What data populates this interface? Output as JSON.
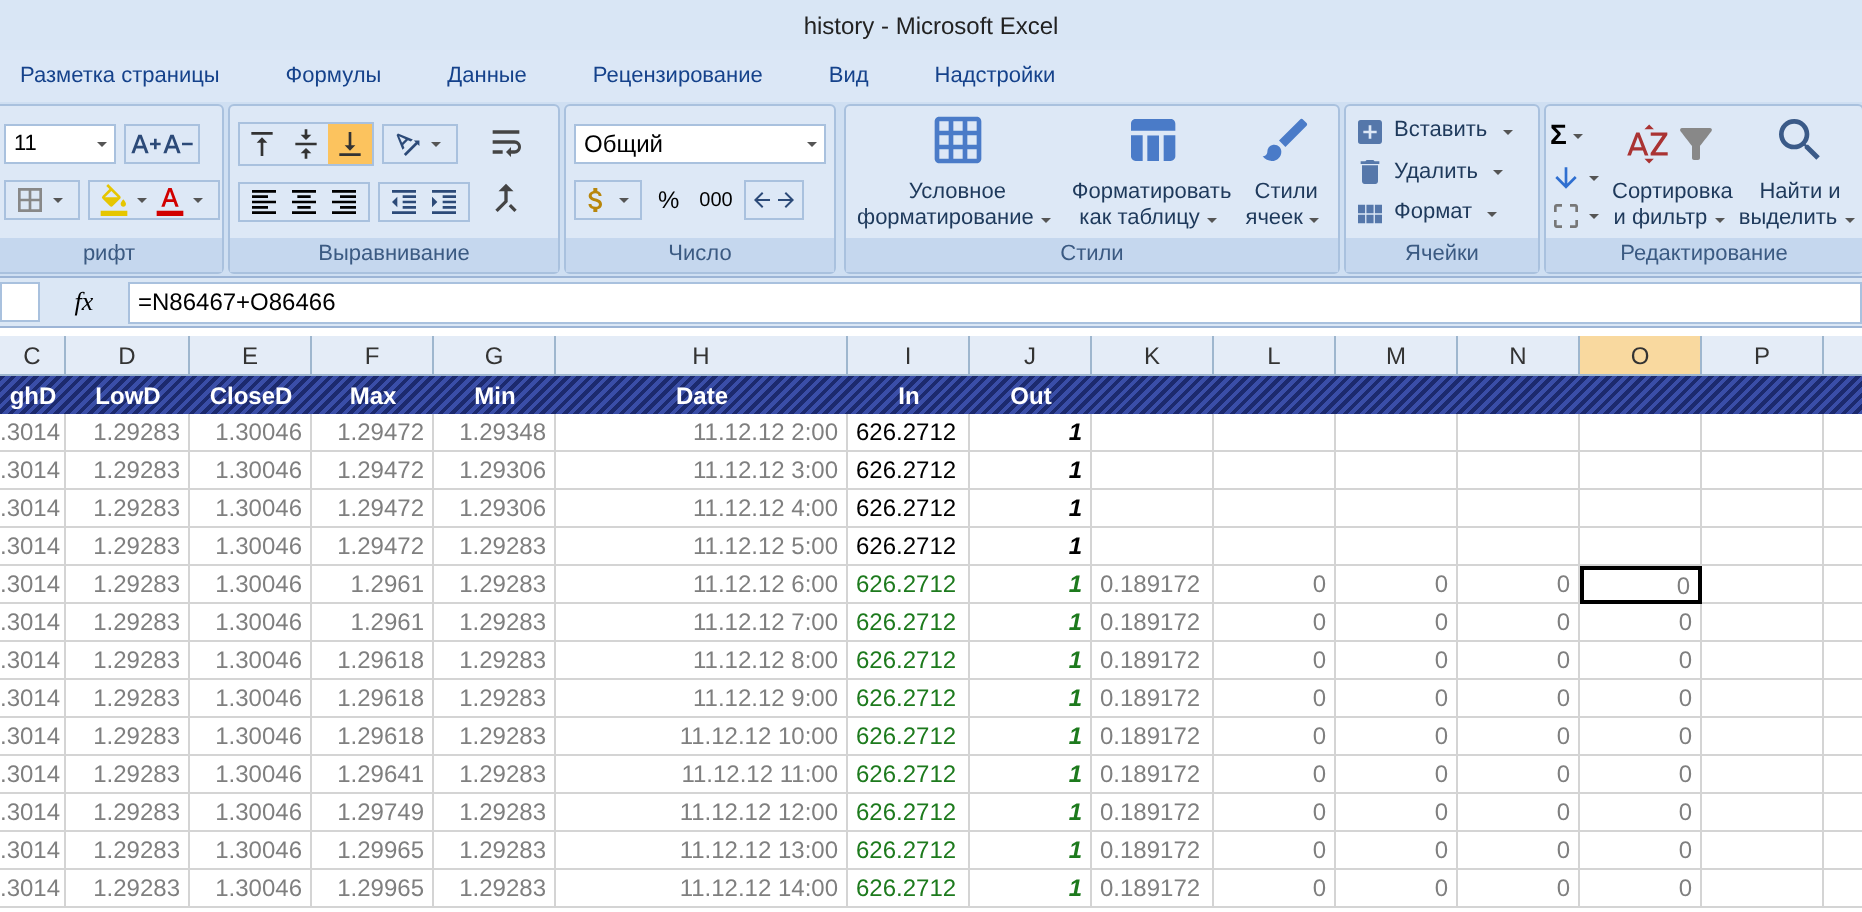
{
  "window": {
    "title": "history - Microsoft Excel"
  },
  "tabs": [
    {
      "label": "Разметка страницы",
      "selected": false
    },
    {
      "label": "Формулы",
      "selected": false
    },
    {
      "label": "Данные",
      "selected": false
    },
    {
      "label": "Рецензирование",
      "selected": false
    },
    {
      "label": "Вид",
      "selected": false
    },
    {
      "label": "Надстройки",
      "selected": false
    }
  ],
  "ribbon": {
    "font": {
      "label": "рифт",
      "size": "11"
    },
    "alignment": {
      "label": "Выравнивание",
      "vertical": [
        {
          "selected": false
        },
        {
          "selected": false
        },
        {
          "selected": true
        }
      ]
    },
    "number": {
      "label": "Число",
      "format": "Общий",
      "percent": "%",
      "thousands": "000"
    },
    "styles": {
      "label": "Стили",
      "buttons": [
        {
          "lines": [
            "Условное",
            "форматирование"
          ]
        },
        {
          "lines": [
            "Форматировать",
            "как таблицу"
          ]
        },
        {
          "lines": [
            "Стили",
            "ячеек"
          ]
        }
      ]
    },
    "cells": {
      "label": "Ячейки",
      "buttons": [
        "Вставить",
        "Удалить",
        "Формат"
      ]
    },
    "editing": {
      "label": "Редактирование",
      "sum": "Σ",
      "buttons": [
        {
          "lines": [
            "Сортировка",
            "и фильтр"
          ]
        },
        {
          "lines": [
            "Найти и",
            "выделить"
          ]
        }
      ]
    }
  },
  "formula_bar": {
    "fx": "fx",
    "formula": "=N86467+O86466"
  },
  "columns": [
    {
      "label": "C",
      "selected": false
    },
    {
      "label": "D",
      "selected": false
    },
    {
      "label": "E",
      "selected": false
    },
    {
      "label": "F",
      "selected": false
    },
    {
      "label": "G",
      "selected": false
    },
    {
      "label": "H",
      "selected": false
    },
    {
      "label": "I",
      "selected": false
    },
    {
      "label": "J",
      "selected": false
    },
    {
      "label": "K",
      "selected": false
    },
    {
      "label": "L",
      "selected": false
    },
    {
      "label": "M",
      "selected": false
    },
    {
      "label": "N",
      "selected": false
    },
    {
      "label": "O",
      "selected": true
    },
    {
      "label": "P",
      "selected": false
    }
  ],
  "header_row": [
    "ghD",
    "LowD",
    "CloseD",
    "Max",
    "Min",
    "Date",
    "In",
    "Out"
  ],
  "rows": [
    {
      "flagged": false,
      "selected": false,
      "cells": [
        ".3014",
        "1.29283",
        "1.30046",
        "1.29472",
        "1.29348",
        "11.12.12 2:00",
        "626.2712",
        "1"
      ]
    },
    {
      "flagged": false,
      "selected": false,
      "cells": [
        ".3014",
        "1.29283",
        "1.30046",
        "1.29472",
        "1.29306",
        "11.12.12 3:00",
        "626.2712",
        "1"
      ]
    },
    {
      "flagged": false,
      "selected": false,
      "cells": [
        ".3014",
        "1.29283",
        "1.30046",
        "1.29472",
        "1.29306",
        "11.12.12 4:00",
        "626.2712",
        "1"
      ]
    },
    {
      "flagged": false,
      "selected": false,
      "cells": [
        ".3014",
        "1.29283",
        "1.30046",
        "1.29472",
        "1.29283",
        "11.12.12 5:00",
        "626.2712",
        "1"
      ]
    },
    {
      "flagged": true,
      "selected": true,
      "cells": [
        ".3014",
        "1.29283",
        "1.30046",
        "1.2961",
        "1.29283",
        "11.12.12 6:00",
        "626.2712",
        "1",
        "0.189172",
        "0",
        "0",
        "0",
        "0"
      ]
    },
    {
      "flagged": true,
      "selected": false,
      "cells": [
        ".3014",
        "1.29283",
        "1.30046",
        "1.2961",
        "1.29283",
        "11.12.12 7:00",
        "626.2712",
        "1",
        "0.189172",
        "0",
        "0",
        "0",
        "0"
      ]
    },
    {
      "flagged": true,
      "selected": false,
      "cells": [
        ".3014",
        "1.29283",
        "1.30046",
        "1.29618",
        "1.29283",
        "11.12.12 8:00",
        "626.2712",
        "1",
        "0.189172",
        "0",
        "0",
        "0",
        "0"
      ]
    },
    {
      "flagged": true,
      "selected": false,
      "cells": [
        ".3014",
        "1.29283",
        "1.30046",
        "1.29618",
        "1.29283",
        "11.12.12 9:00",
        "626.2712",
        "1",
        "0.189172",
        "0",
        "0",
        "0",
        "0"
      ]
    },
    {
      "flagged": true,
      "selected": false,
      "cells": [
        ".3014",
        "1.29283",
        "1.30046",
        "1.29618",
        "1.29283",
        "11.12.12 10:00",
        "626.2712",
        "1",
        "0.189172",
        "0",
        "0",
        "0",
        "0"
      ]
    },
    {
      "flagged": true,
      "selected": false,
      "cells": [
        ".3014",
        "1.29283",
        "1.30046",
        "1.29641",
        "1.29283",
        "11.12.12 11:00",
        "626.2712",
        "1",
        "0.189172",
        "0",
        "0",
        "0",
        "0"
      ]
    },
    {
      "flagged": true,
      "selected": false,
      "cells": [
        ".3014",
        "1.29283",
        "1.30046",
        "1.29749",
        "1.29283",
        "11.12.12 12:00",
        "626.2712",
        "1",
        "0.189172",
        "0",
        "0",
        "0",
        "0"
      ]
    },
    {
      "flagged": true,
      "selected": false,
      "cells": [
        ".3014",
        "1.29283",
        "1.30046",
        "1.29965",
        "1.29283",
        "11.12.12 13:00",
        "626.2712",
        "1",
        "0.189172",
        "0",
        "0",
        "0",
        "0"
      ]
    },
    {
      "flagged": true,
      "selected": false,
      "cells": [
        ".3014",
        "1.29283",
        "1.30046",
        "1.29965",
        "1.29283",
        "11.12.12 14:00",
        "626.2712",
        "1",
        "0.189172",
        "0",
        "0",
        "0",
        "0"
      ]
    }
  ]
}
